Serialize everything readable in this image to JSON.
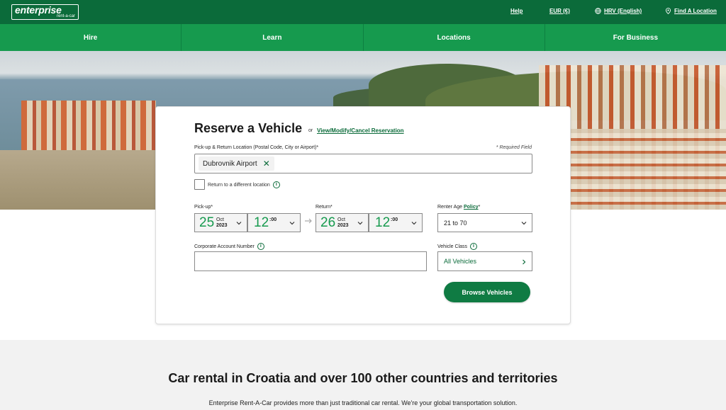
{
  "brand": {
    "logo_main": "enterprise",
    "logo_sub": "rent-a-car",
    "color_dark": "#0b6b3a",
    "color_nav": "#169a4e"
  },
  "topbar": {
    "help": "Help",
    "currency": "EUR (€)",
    "language": "HRV (English)",
    "language_icon": "globe-icon",
    "find_location": "Find A Location",
    "find_location_icon": "map-pin-icon"
  },
  "nav": {
    "items": [
      {
        "label": "Hire"
      },
      {
        "label": "Learn"
      },
      {
        "label": "Locations"
      },
      {
        "label": "For Business"
      }
    ]
  },
  "reservation": {
    "title": "Reserve a Vehicle",
    "or": "or",
    "modify_link": "View/Modify/Cancel Reservation",
    "location_label": "Pick-up & Return Location (Postal Code, City or Airport)*",
    "required_note": "* Required Field",
    "location_value": "Dubrovnik Airport",
    "different_return": "Return to a different location",
    "pickup_label": "Pick-up*",
    "pickup": {
      "day": "25",
      "month": "Oct",
      "year": "2023",
      "hour": "12",
      "minute": ":00"
    },
    "return_label": "Return*",
    "return": {
      "day": "26",
      "month": "Oct",
      "year": "2023",
      "hour": "12",
      "minute": ":00"
    },
    "age_label": "Renter Age",
    "age_policy": "Policy",
    "age_required": "*",
    "age_value": "21 to 70",
    "corporate_label": "Corporate Account Number",
    "corporate_value": "",
    "vehicle_class_label": "Vehicle Class",
    "vehicle_class_value": "All Vehicles",
    "browse_button": "Browse Vehicles"
  },
  "footer_section": {
    "title": "Car rental in Croatia and over 100 other countries and territories",
    "text": "Enterprise Rent-A-Car provides more than just traditional car rental. We're your global transportation solution."
  }
}
